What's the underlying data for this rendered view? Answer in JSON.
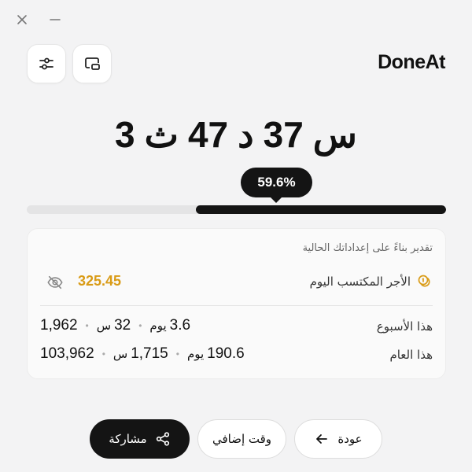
{
  "app": {
    "brand": "DoneAt"
  },
  "timer": {
    "hours": "3",
    "hours_unit": "ث",
    "minutes": "47",
    "minutes_unit": "د",
    "seconds": "37",
    "seconds_unit": "س"
  },
  "progress": {
    "percent_label": "59.6%",
    "fraction": 0.596
  },
  "card": {
    "note": "تقدير بناءً على إعداداتك الحالية",
    "earnings_label": "الأجر المكتسب اليوم",
    "earnings_value": "325.45",
    "week": {
      "label": "هذا الأسبوع",
      "days": "3.6",
      "days_unit": "يوم",
      "hours": "32",
      "hours_unit": "س",
      "amount": "1,962"
    },
    "year": {
      "label": "هذا العام",
      "days": "190.6",
      "days_unit": "يوم",
      "hours": "1,715",
      "hours_unit": "س",
      "amount": "103,962"
    }
  },
  "buttons": {
    "back": "عودة",
    "extra_time": "وقت إضافي",
    "share": "مشاركة"
  },
  "colors": {
    "accent_gold": "#d99b16",
    "dark": "#141414",
    "background": "#f3f3f4"
  },
  "icons": {
    "close": "close-icon",
    "minimize": "minimize-icon",
    "settings": "sliders-icon",
    "pip": "picture-in-picture-icon",
    "eye_off": "eye-off-icon",
    "coins": "coins-icon",
    "arrow": "arrow-left-icon",
    "share": "share-icon"
  }
}
